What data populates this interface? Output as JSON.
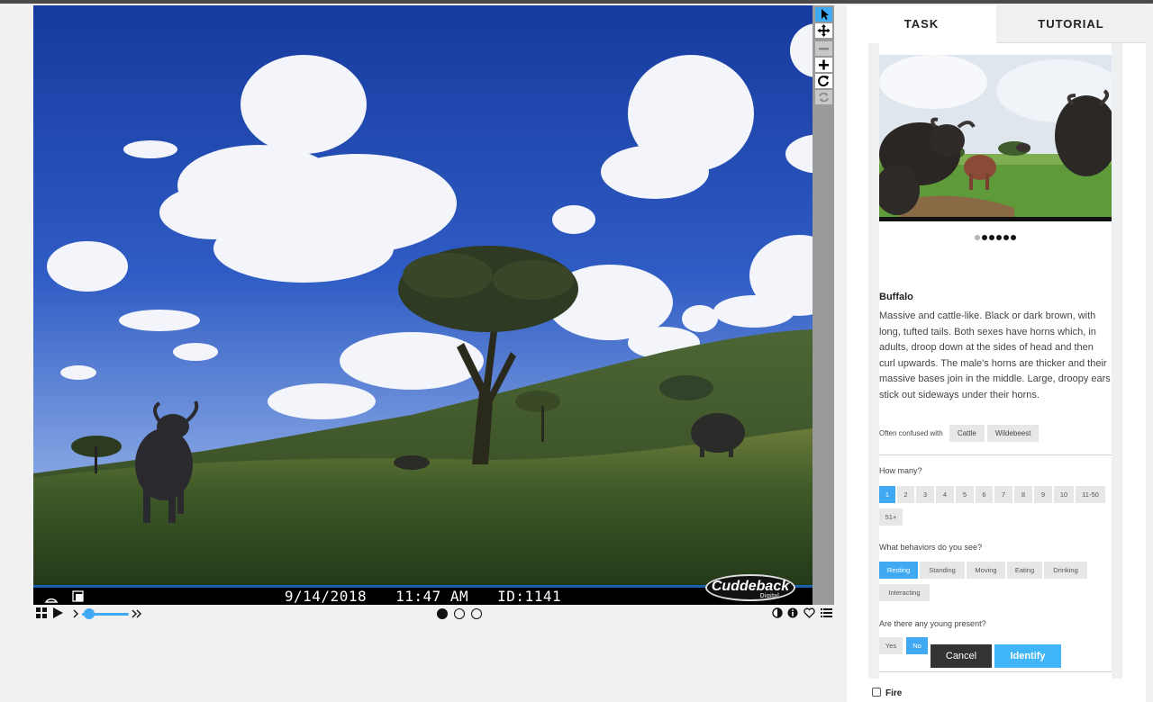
{
  "viewer": {
    "stamp_date": "9/14/2018",
    "stamp_time": "11:47 AM",
    "stamp_id": "ID:1141",
    "camera_brand": "Cuddeback",
    "camera_sub": "Digital"
  },
  "toolbar": {
    "tools": [
      "pointer-icon",
      "move-icon",
      "zoom-out-icon",
      "zoom-in-icon",
      "rotate-icon",
      "reset-icon"
    ],
    "active_tool": "pointer-icon"
  },
  "controls": {
    "frames_total": 3,
    "current_frame": 1,
    "playback_speed_fraction": 0.1
  },
  "tabs": {
    "task": "TASK",
    "tutorial": "TUTORIAL"
  },
  "species": {
    "photo_pages": 6,
    "photo_current": 1,
    "name": "Buffalo",
    "description": "Massive and cattle-like. Black or dark brown, with long, tufted tails. Both sexes have horns which, in adults, droop down at the sides of head and then curl upwards. The male's horns are thicker and their massive bases join in the middle. Large, droopy ears stick out sideways under their horns.",
    "confused_label": "Often confused with",
    "confused": [
      "Cattle",
      "Wildebeest"
    ]
  },
  "questions": {
    "how_many": {
      "label": "How many?",
      "options": [
        "1",
        "2",
        "3",
        "4",
        "5",
        "6",
        "7",
        "8",
        "9",
        "10",
        "11-50",
        "51+"
      ],
      "selected": "1"
    },
    "behaviors": {
      "label": "What behaviors do you see?",
      "options": [
        "Resting",
        "Standing",
        "Moving",
        "Eating",
        "Drinking",
        "Interacting"
      ],
      "selected": [
        "Resting"
      ]
    },
    "young": {
      "label": "Are there any young present?",
      "options": [
        "Yes",
        "No"
      ],
      "selected": "No"
    }
  },
  "buttons": {
    "cancel": "Cancel",
    "identify": "Identify"
  },
  "fire_label": "Fire",
  "colors": {
    "accent": "#40a9f4",
    "dark_button": "#333333"
  }
}
